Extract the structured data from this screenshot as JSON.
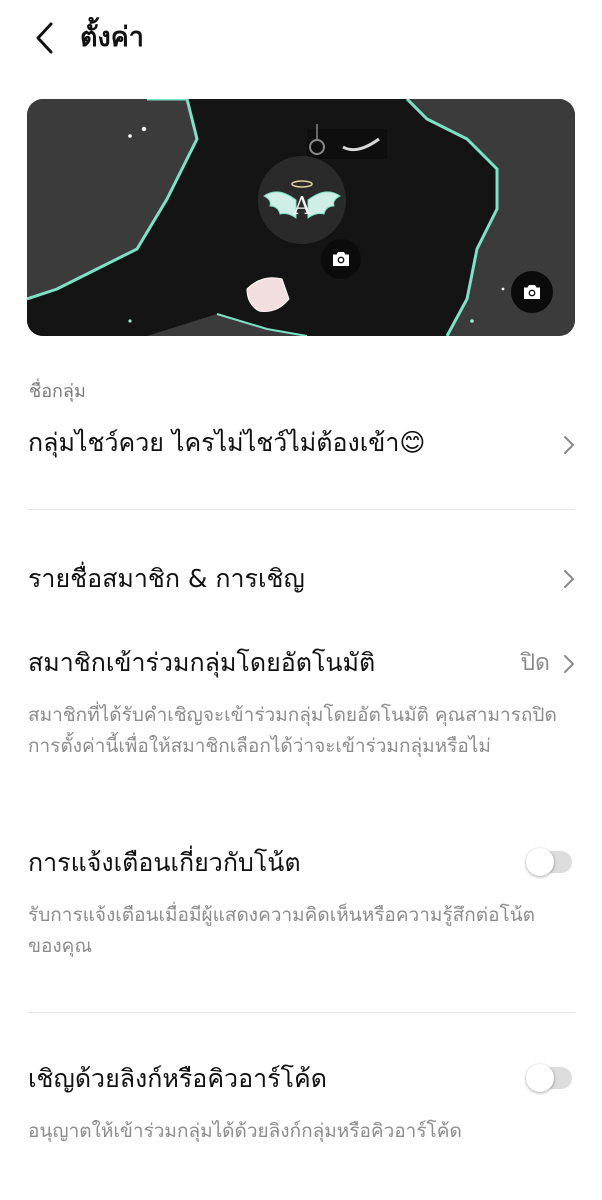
{
  "header": {
    "title": "ตั้งค่า"
  },
  "cover": {
    "avatar_letter": "A"
  },
  "group_name": {
    "label": "ชื่อกลุ่ม",
    "value": "กลุ่มไชว์ควย ไครไม่ไชว์ไม่ต้องเข้า😊"
  },
  "members": {
    "title": "รายชื่อสมาชิก & การเชิญ"
  },
  "auto_join": {
    "title": "สมาชิกเข้าร่วมกลุ่มโดยอัตโนมัติ",
    "value": "ปิด",
    "desc": "สมาชิกที่ได้รับคำเชิญจะเข้าร่วมกลุ่มโดยอัตโนมัติ คุณสามารถปิดการตั้งค่านี้เพื่อให้สมาชิกเลือกได้ว่าจะเข้าร่วมกลุ่มหรือไม่"
  },
  "note_notify": {
    "title": "การแจ้งเตือนเกี่ยวกับโน้ต",
    "desc": "รับการแจ้งเตือนเมื่อมีผู้แสดงความคิดเห็นหรือความรู้สึกต่อโน้ตของคุณ",
    "enabled": false
  },
  "invite_link": {
    "title": "เชิญด้วยลิงก์หรือคิวอาร์โค้ด",
    "desc": "อนุญาตให้เข้าร่วมกลุ่มได้ด้วยลิงก์กลุ่มหรือคิวอาร์โค้ด",
    "enabled": false
  },
  "colors": {
    "toggle_off": "#dcdcdc",
    "secondary_text": "#8c8c8c",
    "cover_bg": "#3b3b3b",
    "outline_accent": "#7ee0c4"
  }
}
